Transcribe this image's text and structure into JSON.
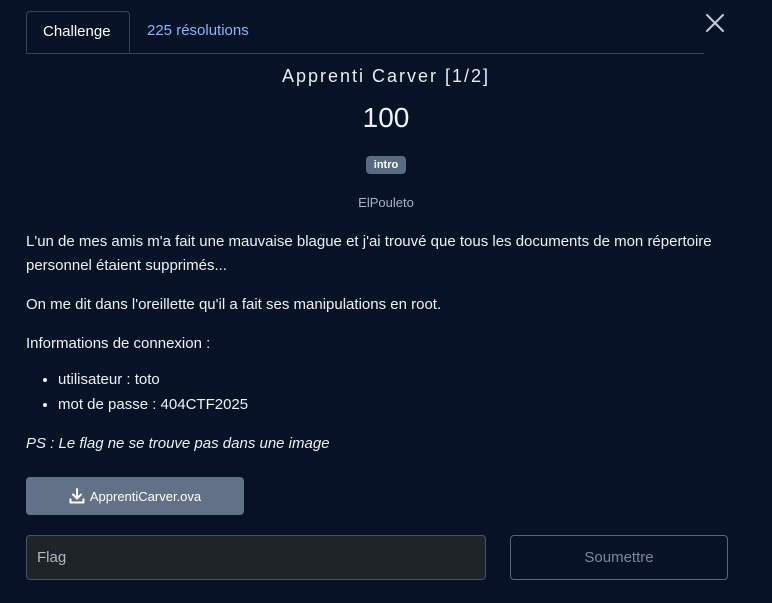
{
  "tabs": {
    "challenge": "Challenge",
    "solves": "225 résolutions"
  },
  "challenge": {
    "title": "Apprenti Carver [1/2]",
    "points": "100",
    "category": "intro",
    "author": "ElPouleto"
  },
  "description": {
    "paragraph1": "L'un de mes amis m'a fait une mauvaise blague et j'ai trouvé que tous les documents de mon répertoire personnel étaient supprimés...",
    "paragraph2": "On me dit dans l'oreillette qu'il a fait ses manipulations en root.",
    "paragraph3": "Informations de connexion :",
    "credentials": [
      "utilisateur : toto",
      "mot de passe : 404CTF2025"
    ],
    "ps": "PS : Le flag ne se trouve pas dans une image"
  },
  "download": {
    "label": "ApprentiCarver.ova",
    "icon": "download-icon"
  },
  "form": {
    "flag_placeholder": "Flag",
    "flag_value": "",
    "submit_label": "Soumettre"
  },
  "colors": {
    "background": "#061226",
    "link": "#8bb3ff",
    "badge": "#5a6a80",
    "download_button": "#637187"
  }
}
